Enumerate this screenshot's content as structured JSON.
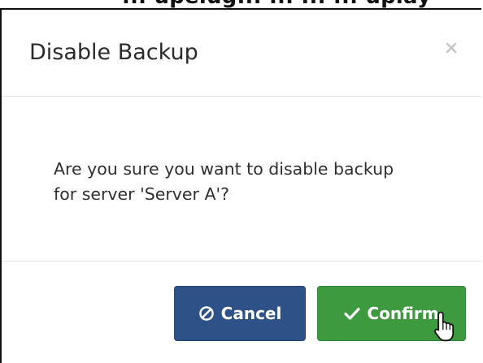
{
  "top_caption": "... upelug... ... ... ... uplay",
  "dialog": {
    "title": "Disable Backup",
    "close_icon": "close-icon",
    "message_line1": "Are you sure you want to disable backup",
    "message_line2": "for server 'Server A'?",
    "cancel_label": "Cancel",
    "cancel_icon": "ban-icon",
    "confirm_label": "Confirm",
    "confirm_icon": "check-icon"
  },
  "cursor": "hand-pointer-icon",
  "colors": {
    "cancel": "#2e5288",
    "confirm": "#3d9a3f",
    "border": "#111111",
    "divider": "#e2e2e2"
  }
}
